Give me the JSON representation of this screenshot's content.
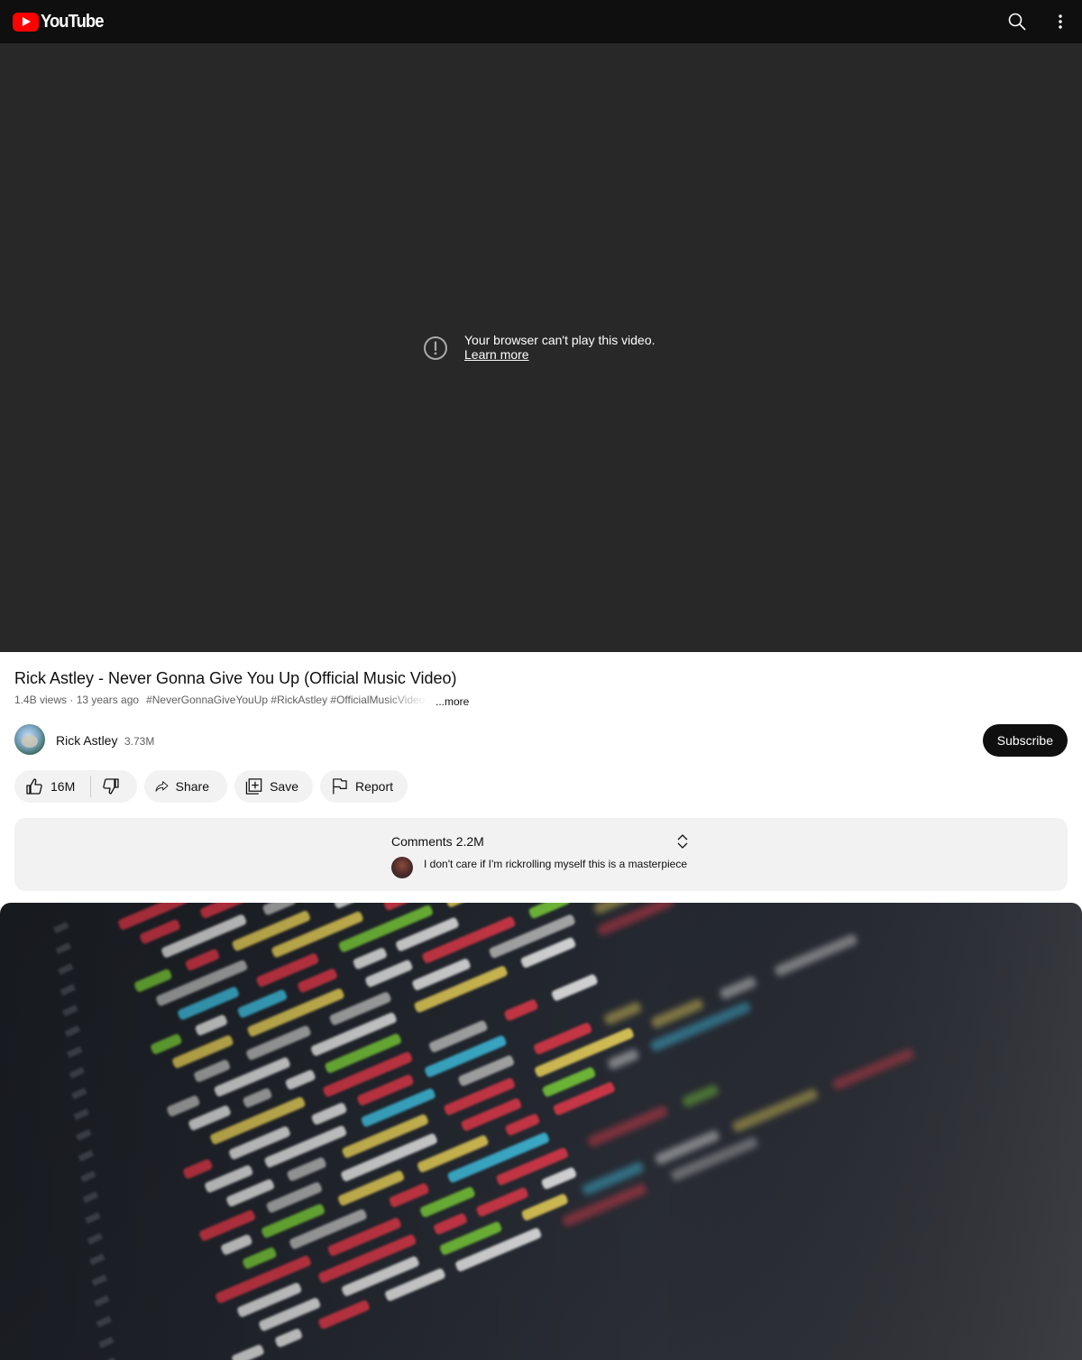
{
  "app": {
    "logo_text": "YouTube"
  },
  "topbar": {
    "search_icon": "search-icon",
    "more_icon": "more-vert-icon"
  },
  "player": {
    "error_message": "Your browser can't play this video.",
    "learn_more": "Learn more"
  },
  "video": {
    "title": "Rick Astley - Never Gonna Give You Up (Official Music Video)",
    "views_date": "1.4B views · 13 years ago",
    "hashtags": "#NeverGonnaGiveYouUp #RickAstley #OfficialMusicVideo",
    "more_label": "...more"
  },
  "channel": {
    "name": "Rick Astley",
    "subscribers": "3.73M",
    "subscribe_label": "Subscribe"
  },
  "actions": {
    "like_count": "16M",
    "share_label": "Share",
    "save_label": "Save",
    "report_label": "Report"
  },
  "comments": {
    "label": "Comments",
    "count": "2.2M",
    "top_comment": "I don't care if I'm rickrolling myself this is a masterpiece"
  },
  "colors": {
    "brand_red": "#ff0000",
    "topbar_bg": "#0f0f0f",
    "player_bg": "#282828",
    "pill_bg": "#f2f2f2"
  }
}
